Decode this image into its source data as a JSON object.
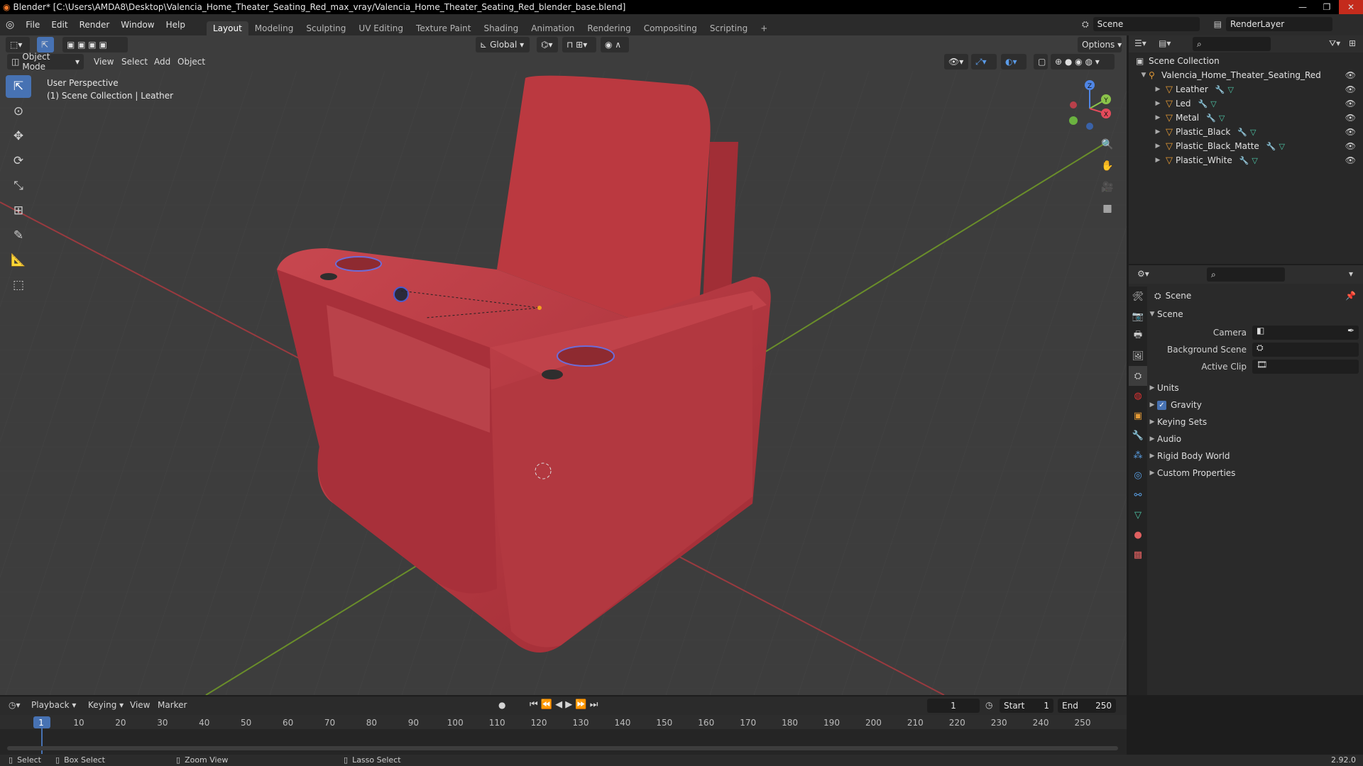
{
  "window": {
    "title": "Blender* [C:\\Users\\AMDA8\\Desktop\\Valencia_Home_Theater_Seating_Red_max_vray/Valencia_Home_Theater_Seating_Red_blender_base.blend]"
  },
  "menu": {
    "items": [
      "File",
      "Edit",
      "Render",
      "Window",
      "Help"
    ]
  },
  "workspaces": [
    "Layout",
    "Modeling",
    "Sculpting",
    "UV Editing",
    "Texture Paint",
    "Shading",
    "Animation",
    "Rendering",
    "Compositing",
    "Scripting"
  ],
  "scene_selector": {
    "scene": "Scene",
    "view_layer": "RenderLayer"
  },
  "viewport_header": {
    "mode": "Object Mode",
    "menus": [
      "View",
      "Select",
      "Add",
      "Object"
    ],
    "orientation": "Global",
    "options": "Options"
  },
  "viewport_info": {
    "line1": "User Perspective",
    "line2": "(1) Scene Collection | Leather"
  },
  "gizmo": {
    "x": "X",
    "y": "Y",
    "z": "Z"
  },
  "outliner": {
    "root": "Scene Collection",
    "collection": "Valencia_Home_Theater_Seating_Red",
    "objects": [
      "Leather",
      "Led",
      "Metal",
      "Plastic_Black",
      "Plastic_Black_Matte",
      "Plastic_White"
    ]
  },
  "properties": {
    "breadcrumb": "Scene",
    "panel": "Scene",
    "fields": [
      {
        "label": "Camera"
      },
      {
        "label": "Background Scene"
      },
      {
        "label": "Active Clip"
      }
    ],
    "subpanels": [
      "Units",
      "Gravity",
      "Keying Sets",
      "Audio",
      "Rigid Body World",
      "Custom Properties"
    ],
    "gravity_checked": true
  },
  "timeline": {
    "menus": [
      "Playback",
      "Keying",
      "View",
      "Marker"
    ],
    "current_frame": "1",
    "start_label": "Start",
    "start": "1",
    "end_label": "End",
    "end": "250",
    "ticks": [
      "1",
      "10",
      "20",
      "30",
      "40",
      "50",
      "60",
      "70",
      "80",
      "90",
      "100",
      "110",
      "120",
      "130",
      "140",
      "150",
      "160",
      "170",
      "180",
      "190",
      "200",
      "210",
      "220",
      "230",
      "240",
      "250"
    ]
  },
  "statusbar": {
    "select": "Select",
    "box_select": "Box Select",
    "zoom_view": "Zoom View",
    "lasso_select": "Lasso Select",
    "version": "2.92.0"
  },
  "colors": {
    "chair": "#b8353d",
    "active_tab": "#4772b3",
    "object_icon": "#e49a35"
  }
}
